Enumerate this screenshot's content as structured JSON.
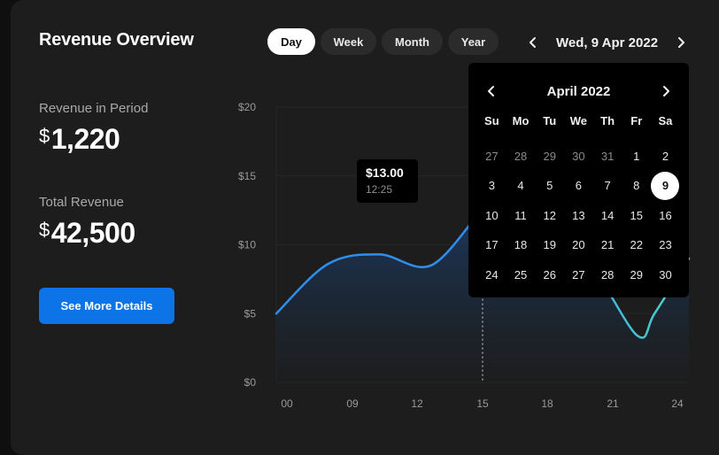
{
  "header": {
    "title": "Revenue Overview"
  },
  "period_tabs": [
    {
      "label": "Day",
      "active": true
    },
    {
      "label": "Week",
      "active": false
    },
    {
      "label": "Month",
      "active": false
    },
    {
      "label": "Year",
      "active": false
    }
  ],
  "date_nav": {
    "label": "Wed, 9 Apr 2022",
    "prev_icon": "chevron-left-icon",
    "next_icon": "chevron-right-icon"
  },
  "stats": {
    "period": {
      "label": "Revenue in Period",
      "currency": "$",
      "value": "1,220"
    },
    "total": {
      "label": "Total Revenue",
      "currency": "$",
      "value": "42,500"
    }
  },
  "cta": {
    "label": "See More Details"
  },
  "chart_data": {
    "type": "area",
    "y_ticks": [
      "$20",
      "$15",
      "$10",
      "$5",
      "$0"
    ],
    "ylim": [
      0,
      20
    ],
    "x_ticks": [
      "00",
      "09",
      "12",
      "15",
      "18",
      "21",
      "24"
    ],
    "x": [
      0,
      3,
      6,
      9,
      12,
      13,
      15,
      18,
      21,
      22,
      24
    ],
    "y": [
      5.0,
      8.6,
      9.3,
      8.5,
      12.5,
      12.5,
      7.6,
      8.6,
      3.4,
      5.0,
      9.0
    ],
    "grid": true,
    "tooltip": {
      "value": "$13.00",
      "time": "12:25",
      "x": 12.0,
      "y": 12.5
    },
    "colors": {
      "line_start": "#2e8ff0",
      "line_end": "#4fd4c6",
      "fill_top": "#1b3a63",
      "fill_bottom": "#1d1d1d"
    }
  },
  "calendar": {
    "month_label": "April 2022",
    "prev_icon": "chevron-left-icon",
    "next_icon": "chevron-right-icon",
    "weekdays": [
      "Su",
      "Mo",
      "Tu",
      "We",
      "Th",
      "Fr",
      "Sa"
    ],
    "days": [
      {
        "d": "27",
        "muted": true
      },
      {
        "d": "28",
        "muted": true
      },
      {
        "d": "29",
        "muted": true
      },
      {
        "d": "30",
        "muted": true
      },
      {
        "d": "31",
        "muted": true
      },
      {
        "d": "1"
      },
      {
        "d": "2"
      },
      {
        "d": "3"
      },
      {
        "d": "4"
      },
      {
        "d": "5"
      },
      {
        "d": "6"
      },
      {
        "d": "7"
      },
      {
        "d": "8"
      },
      {
        "d": "9",
        "selected": true
      },
      {
        "d": "10"
      },
      {
        "d": "11"
      },
      {
        "d": "12"
      },
      {
        "d": "13"
      },
      {
        "d": "14"
      },
      {
        "d": "15"
      },
      {
        "d": "16"
      },
      {
        "d": "17"
      },
      {
        "d": "18"
      },
      {
        "d": "19"
      },
      {
        "d": "20"
      },
      {
        "d": "21"
      },
      {
        "d": "22"
      },
      {
        "d": "23"
      },
      {
        "d": "24"
      },
      {
        "d": "25"
      },
      {
        "d": "26"
      },
      {
        "d": "27"
      },
      {
        "d": "28"
      },
      {
        "d": "29"
      },
      {
        "d": "30"
      }
    ]
  }
}
